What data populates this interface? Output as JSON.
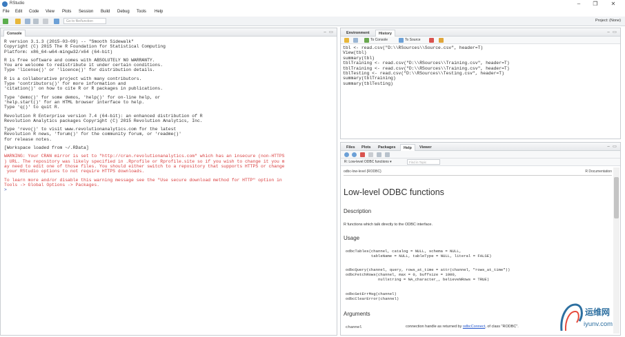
{
  "window": {
    "title": "RStudio"
  },
  "menu": [
    "File",
    "Edit",
    "Code",
    "View",
    "Plots",
    "Session",
    "Build",
    "Debug",
    "Tools",
    "Help"
  ],
  "toolbar": {
    "goto_placeholder": "Go to file/function",
    "project": "Project: (None)"
  },
  "console": {
    "tab": "Console",
    "lines": [
      "R version 3.1.3 (2015-03-09) -- \"Smooth Sidewalk\"",
      "Copyright (C) 2015 The R Foundation for Statistical Computing",
      "Platform: x86_64-w64-mingw32/x64 (64-bit)",
      "",
      "R is free software and comes with ABSOLUTELY NO WARRANTY.",
      "You are welcome to redistribute it under certain conditions.",
      "Type 'license()' or 'licence()' for distribution details.",
      "",
      "R is a collaborative project with many contributors.",
      "Type 'contributors()' for more information and",
      "'citation()' on how to cite R or R packages in publications.",
      "",
      "Type 'demo()' for some demos, 'help()' for on-line help, or",
      "'help.start()' for an HTML browser interface to help.",
      "Type 'q()' to quit R.",
      "",
      "Revolution R Enterprise version 7.4 (64-bit): an enhanced distribution of R",
      "Revolution Analytics packages Copyright (C) 2015 Revolution Analytics, Inc.",
      "",
      "Type 'revo()' to visit www.revolutionanalytics.com for the latest",
      "Revolution R news, 'forum()' for the community forum, or 'readme()'",
      "for release notes.",
      "",
      "[Workspace loaded from ~/.RData]",
      ""
    ],
    "warning_lines": [
      "WARNING: Your CRAN mirror is set to \"http://cran.revolutionanalytics.com\" which has an insecure (non-HTTPS",
      ") URL. The repository was likely specified in .Rprofile or Rprofile.site so if you wish to change it you m",
      "ay need to edit one of those files. You should either switch to a repository that supports HTTPS or change",
      " your RStudio options to not require HTTPS downloads.",
      "",
      "To learn more and/or disable this warning message see the \"Use secure download method for HTTP\" option in",
      "Tools -> Global Options -> Packages."
    ],
    "prompt": ">"
  },
  "env": {
    "tabs": [
      "Environment",
      "History"
    ],
    "toolbar": {
      "to_console": "To Console",
      "to_source": "To Source"
    },
    "history": [
      "tbl <- read.csv(\"D:\\\\RSources\\\\Source.csv\", header=T)",
      "View(tbl)",
      "summary(tbl)",
      "tblTraining <- read.csv(\"D:\\\\RSources\\\\Training.csv\", header=T)",
      "tblTraining <- read.csv(\"D:\\\\RSources\\\\Training.csv\", header=T)",
      "tblTesting <- read.csv(\"D:\\\\RSources\\\\Testing.csv\", header=T)",
      "summary(tblTraining)",
      "summary(tblTesting)"
    ]
  },
  "help": {
    "tabs": [
      "Files",
      "Plots",
      "Packages",
      "Help",
      "Viewer"
    ],
    "topic": "R: Low-level ODBC functions ▾",
    "find_placeholder": "Find in Topic",
    "meta_left": "odbc-low-level {RODBC}",
    "meta_right": "R Documentation",
    "title": "Low-level ODBC functions",
    "h_description": "Description",
    "description": "R functions which talk directly to the ODBC interface.",
    "h_usage": "Usage",
    "usage1": "odbcTables(channel, catalog = NULL, schema = NULL,\n           tableName = NULL, tableType = NULL, literal = FALSE)",
    "usage2": "odbcQuery(channel, query, rows_at_time = attr(channel, \"rows_at_time\"))\nodbcFetchRows(channel, max = 0, buffsize = 1000,\n              nullstring = NA_character_, believeNRows = TRUE)",
    "usage3": "odbcGetErrMsg(channel)\nodbcClearError(channel)",
    "h_arguments": "Arguments",
    "arg_name": "channel",
    "arg_desc_pre": "connection handle as returned by ",
    "arg_desc_link": "odbcConnect",
    "arg_desc_post": ", of class \"RODBC\"."
  },
  "watermark": {
    "cn": "运维网",
    "en": "iyunv.com"
  }
}
